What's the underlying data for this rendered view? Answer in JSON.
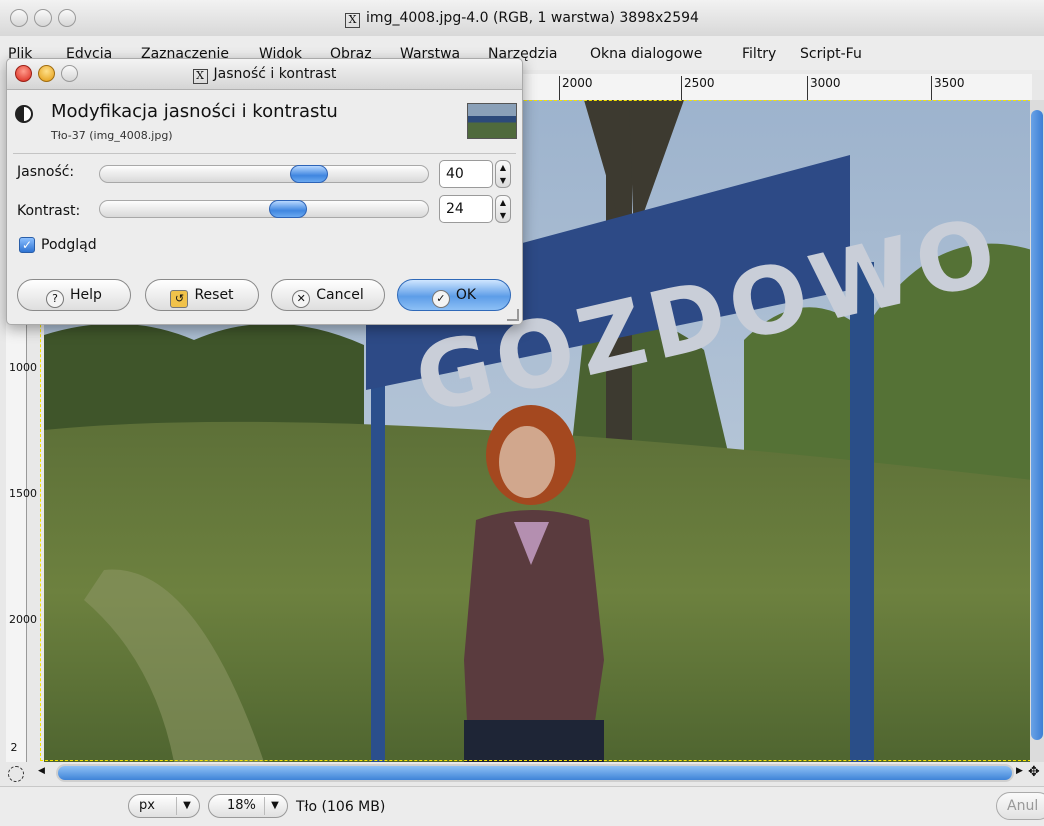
{
  "window": {
    "title": "img_4008.jpg-4.0 (RGB, 1 warstwa) 3898x2594"
  },
  "menu": [
    "Plik",
    "Edycja",
    "Zaznaczenie",
    "Widok",
    "Obraz",
    "Warstwa",
    "Narzędzia",
    "Okna dialogowe",
    "Filtry",
    "Script-Fu"
  ],
  "ruler": {
    "h_labels": [
      "2000",
      "2500",
      "3000",
      "3500"
    ],
    "v_labels": [
      "1000",
      "1500",
      "2000",
      "2"
    ]
  },
  "image": {
    "sign_text": "GOZDOWO",
    "colors": {
      "sky": "#a9bdd3",
      "grass": "#586b3a",
      "sign": "#2d4a86"
    }
  },
  "dialog": {
    "title": "Jasność i kontrast",
    "heading": "Modyfikacja jasności i kontrastu",
    "subtitle": "Tło-37 (img_4008.jpg)",
    "brightness": {
      "label": "Jasność:",
      "value": "40",
      "fraction": 0.65
    },
    "contrast": {
      "label": "Kontrast:",
      "value": "24",
      "fraction": 0.58
    },
    "preview_label": "Podgląd",
    "preview_checked": true,
    "buttons": {
      "help": "Help",
      "reset": "Reset",
      "cancel": "Cancel",
      "ok": "OK"
    }
  },
  "statusbar": {
    "unit": "px",
    "zoom": "18%",
    "layer_info": "Tło (106 MB)",
    "cancel_partial": "Anul"
  }
}
